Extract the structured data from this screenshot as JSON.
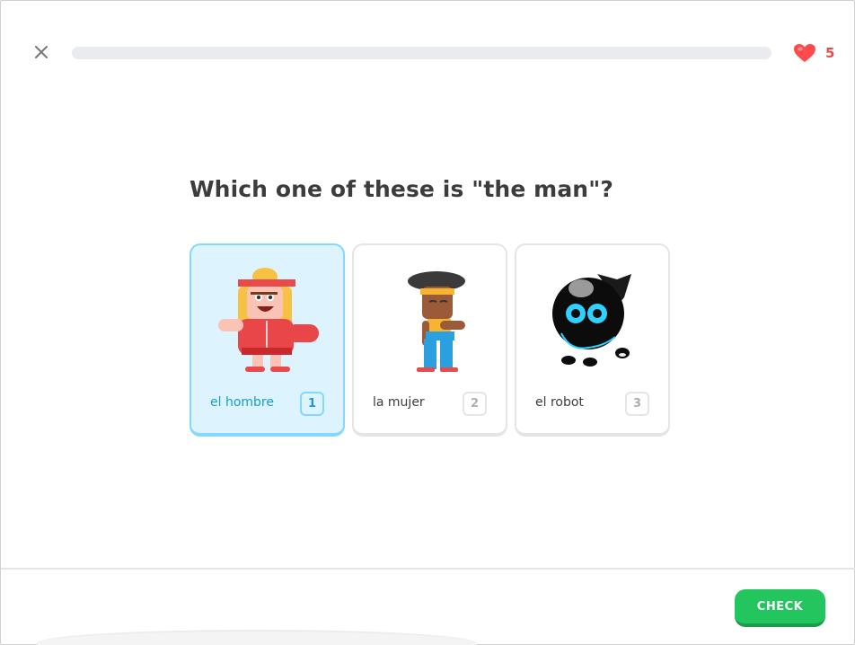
{
  "header": {
    "close_icon": "close-icon",
    "progress": 0,
    "hearts_icon": "heart-icon",
    "hearts_count": "5"
  },
  "question": "Which one of these is \"the man\"?",
  "choices": [
    {
      "label": "el hombre",
      "key": "1",
      "selected": true,
      "art": "man-character"
    },
    {
      "label": "la mujer",
      "key": "2",
      "selected": false,
      "art": "woman-character"
    },
    {
      "label": "el robot",
      "key": "3",
      "selected": false,
      "art": "robot-character"
    }
  ],
  "footer": {
    "check_label": "CHECK"
  },
  "colors": {
    "accent_blue": "#1899d6",
    "selected_bg": "#ddf4ff",
    "check_green": "#22c55e",
    "heart_red": "#e74b4b"
  }
}
